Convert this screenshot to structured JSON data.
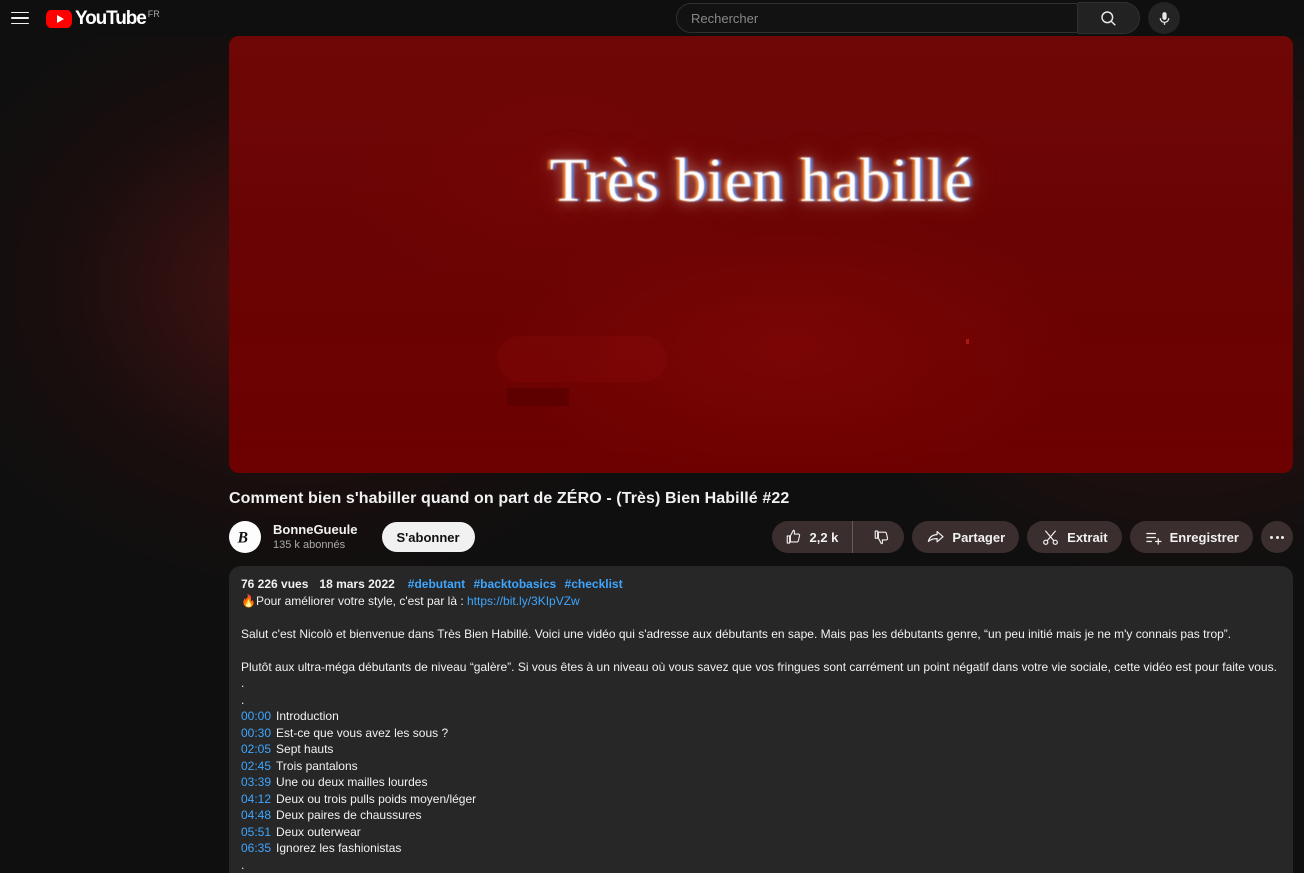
{
  "masthead": {
    "menu_icon": "hamburger-icon",
    "logo_text": "YouTube",
    "logo_country": "FR",
    "search_placeholder": "Rechercher",
    "search_value": "",
    "search_icon": "search-icon",
    "mic_icon": "microphone-icon"
  },
  "player": {
    "art_text": "Très bien habillé",
    "bg_color": "#6e0000"
  },
  "video": {
    "title": "Comment bien s'habiller quand on part de ZÉRO - (Très) Bien Habillé #22"
  },
  "owner": {
    "avatar_letter": "B",
    "channel_name": "BonneGueule",
    "subscribers": "135 k abonnés",
    "subscribe_label": "S'abonner"
  },
  "actions": {
    "like_count": "2,2 k",
    "like_icon": "thumbs-up-icon",
    "dislike_icon": "thumbs-down-icon",
    "share_label": "Partager",
    "share_icon": "share-arrow-icon",
    "clip_label": "Extrait",
    "clip_icon": "scissors-icon",
    "save_label": "Enregistrer",
    "save_icon": "save-to-playlist-icon",
    "more_icon": "more-horizontal-icon"
  },
  "description": {
    "views": "76 226 vues",
    "date": "18 mars 2022",
    "hashtags": [
      "#debutant",
      "#backtobasics",
      "#checklist"
    ],
    "promo_emoji": "🔥",
    "promo_text": "Pour améliorer votre style, c'est par là : ",
    "promo_link": "https://bit.ly/3KIpVZw",
    "paragraph1": "Salut c'est Nicolò et bienvenue dans Très Bien Habillé. Voici une vidéo qui s'adresse aux débutants en sape. Mais pas les débutants genre, “un peu initié mais je ne m'y connais pas trop”.",
    "paragraph2": "Plutôt aux ultra-méga débutants de niveau “galère”. Si vous êtes à un niveau où vous savez que vos fringues sont carrément un point négatif dans votre vie sociale, cette vidéo est pour faite vous.",
    "dot1": ".",
    "dot2": ".",
    "dot_end": ".",
    "chapters": [
      {
        "time": "00:00",
        "label": "Introduction"
      },
      {
        "time": "00:30",
        "label": "Est-ce que vous avez les sous ?"
      },
      {
        "time": "02:05",
        "label": "Sept hauts"
      },
      {
        "time": "02:45",
        "label": "Trois pantalons"
      },
      {
        "time": "03:39",
        "label": "Une ou deux mailles lourdes"
      },
      {
        "time": "04:12",
        "label": "Deux ou trois pulls poids moyen/léger"
      },
      {
        "time": "04:48",
        "label": "Deux paires de chaussures"
      },
      {
        "time": "05:51",
        "label": "Deux outerwear"
      },
      {
        "time": "06:35",
        "label": "Ignorez les fashionistas"
      }
    ]
  },
  "colors": {
    "accent_link": "#3ea6ff",
    "brand_red": "#ff0000",
    "page_bg": "#0f0f0f",
    "desc_bg": "#272727"
  }
}
